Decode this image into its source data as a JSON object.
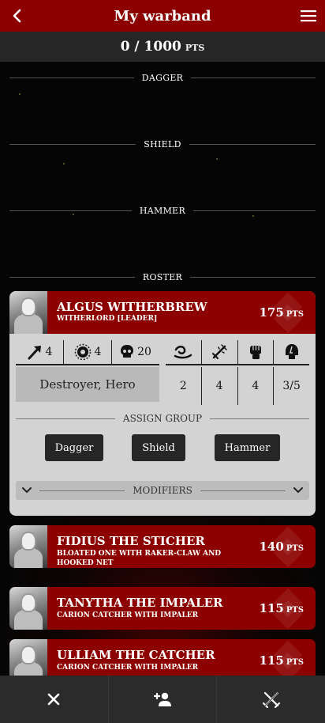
{
  "header": {
    "title": "My warband",
    "back_icon": "back-arrow-icon",
    "menu_icon": "hamburger-menu-icon",
    "color": "#8d0000"
  },
  "points": {
    "value": "0 / 1000",
    "unit": "PTS"
  },
  "groups": [
    {
      "label": "DAGGER"
    },
    {
      "label": "SHIELD"
    },
    {
      "label": "HAMMER"
    },
    {
      "label": "ROSTER"
    }
  ],
  "expanded_fighter": {
    "name": "ALGUS WITHERBREW",
    "type": "WITHERLORD [LEADER]",
    "points": "175",
    "points_unit": "PTS",
    "stats": [
      {
        "icon": "move-arrow-icon",
        "value": "4"
      },
      {
        "icon": "toughness-shield-icon",
        "value": "4"
      },
      {
        "icon": "wounds-skull-icon",
        "value": "20"
      }
    ],
    "keywords": "Destroyer, Hero",
    "weapon": {
      "icons": [
        "range-icon",
        "attacks-sword-icon",
        "strength-fist-icon",
        "damage-skull-icon"
      ],
      "values": [
        "2",
        "4",
        "4",
        "3/5"
      ]
    },
    "assign_group_label": "ASSIGN GROUP",
    "group_buttons": [
      "Dagger",
      "Shield",
      "Hammer"
    ],
    "modifiers_label": "MODIFIERS"
  },
  "fighters": [
    {
      "name": "FIDIUS THE STICHER",
      "type": "BLOATED ONE WITH RAKER-CLAW AND HOOKED NET",
      "points": "140",
      "points_unit": "PTS"
    },
    {
      "name": "TANYTHA THE IMPALER",
      "type": "CARION CATCHER WITH IMPALER",
      "points": "115",
      "points_unit": "PTS"
    },
    {
      "name": "ULLIAM THE CATCHER",
      "type": "CARION CATCHER WITH IMPALER",
      "points": "115",
      "points_unit": "PTS"
    }
  ],
  "bottom_nav": [
    {
      "icon": "close-icon"
    },
    {
      "icon": "add-fighter-icon"
    },
    {
      "icon": "battle-crossed-swords-icon"
    }
  ]
}
